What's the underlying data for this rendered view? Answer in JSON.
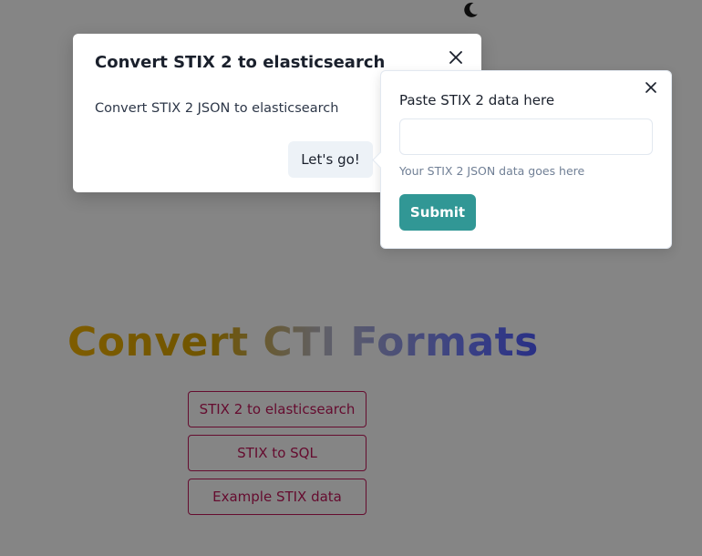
{
  "page": {
    "hero_title": "Convert CTI Formats",
    "theme_toggle_icon": "moon-icon",
    "converter_buttons": [
      {
        "label": "STIX 2 to elasticsearch"
      },
      {
        "label": "STIX to SQL"
      },
      {
        "label": "Example STIX data"
      }
    ],
    "colors": {
      "accent": "#c2185b",
      "title_gradient_start": "#f2b100",
      "title_gradient_end": "#4f5bff"
    }
  },
  "modal": {
    "title": "Convert STIX 2 to elasticsearch",
    "body": "Convert STIX 2 JSON to elasticsearch",
    "action_label": "Let's go!",
    "close_icon": "close-icon"
  },
  "popover": {
    "field_label": "Paste STIX 2 data here",
    "input_value": "",
    "helper_text": "Your STIX 2 JSON data goes here",
    "submit_label": "Submit",
    "close_icon": "close-icon",
    "colors": {
      "submit": "#319795"
    }
  }
}
